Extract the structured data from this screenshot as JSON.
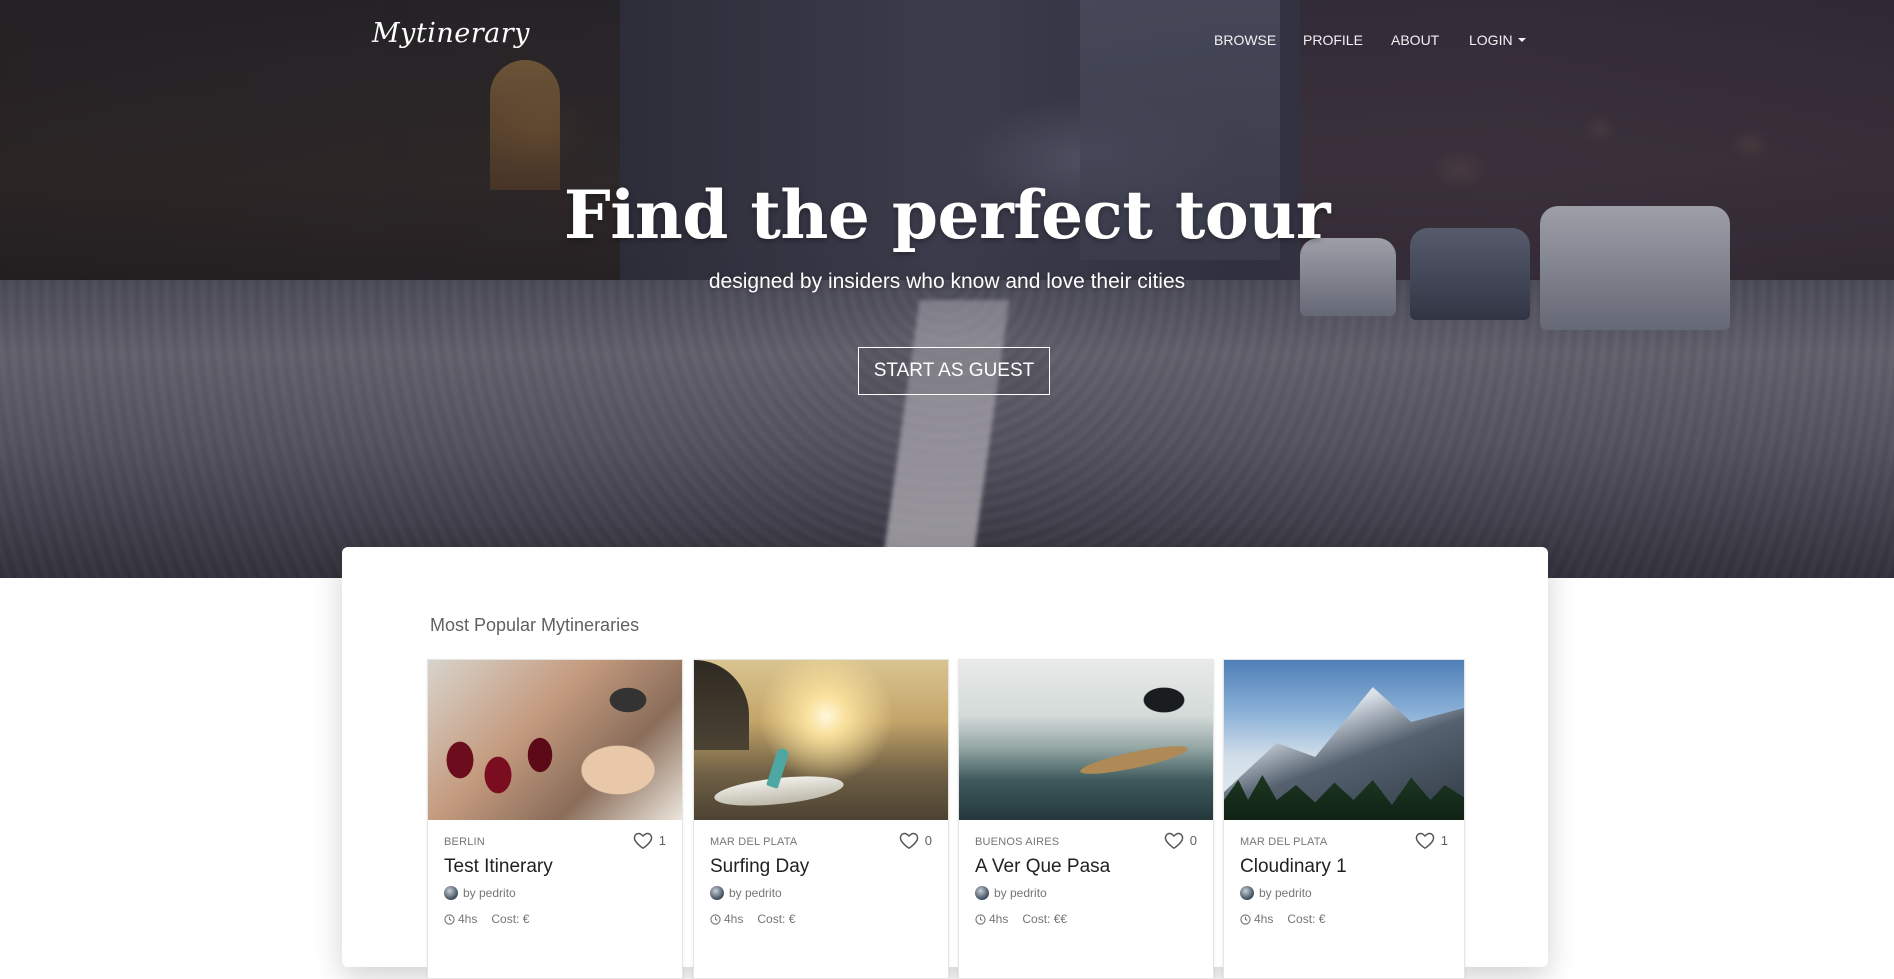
{
  "brand": "Mytinerary",
  "nav": {
    "browse": "BROWSE",
    "profile": "PROFILE",
    "about": "ABOUT",
    "login": "LOGIN"
  },
  "hero": {
    "title": "Find the perfect tour",
    "subtitle": "designed by insiders who know and love their cities",
    "cta": "START AS GUEST"
  },
  "popular": {
    "heading": "Most Popular Mytineraries",
    "cards": [
      {
        "city": "BERLIN",
        "likes": "1",
        "title": "Test Itinerary",
        "author": "by pedrito",
        "duration": "4hs",
        "cost": "Cost: €",
        "image": "wine-glasses"
      },
      {
        "city": "MAR DEL PLATA",
        "likes": "0",
        "title": "Surfing Day",
        "author": "by pedrito",
        "duration": "4hs",
        "cost": "Cost: €",
        "image": "beach-surfboard"
      },
      {
        "city": "BUENOS AIRES",
        "likes": "0",
        "title": "A Ver Que Pasa",
        "author": "by pedrito",
        "duration": "4hs",
        "cost": "Cost: €€",
        "image": "surfer-wave"
      },
      {
        "city": "MAR DEL PLATA",
        "likes": "1",
        "title": "Cloudinary 1",
        "author": "by pedrito",
        "duration": "4hs",
        "cost": "Cost: €",
        "image": "snowy-mountain"
      }
    ]
  },
  "colors": {
    "text_primary": "#212121",
    "text_secondary": "#757575",
    "hero_text": "#ffffff"
  },
  "icons": {
    "like": "heart-outline-icon",
    "duration": "clock-icon",
    "login_menu": "caret-down-icon"
  }
}
